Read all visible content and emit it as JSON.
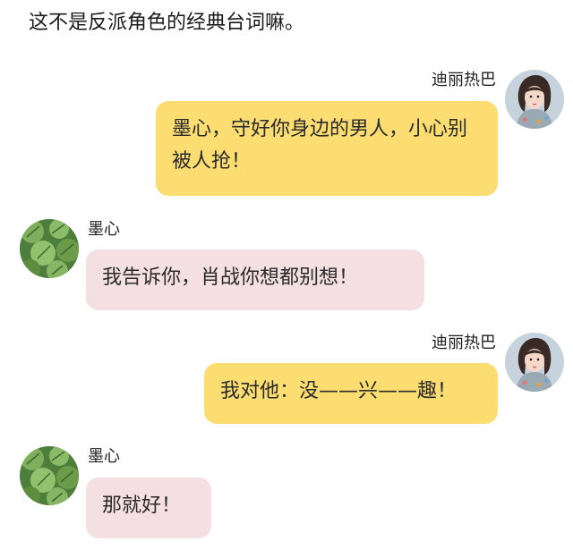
{
  "intro_text": "这不是反派角色的经典台词嘛。",
  "messages": [
    {
      "side": "right",
      "sender": "迪丽热巴",
      "text": "墨心，守好你身边的男人，小心别被人抢！",
      "avatar": "female-portrait-avatar"
    },
    {
      "side": "left",
      "sender": "墨心",
      "text": "我告诉你，肖战你想都别想！",
      "avatar": "green-leaf-avatar"
    },
    {
      "side": "right",
      "sender": "迪丽热巴",
      "text": "我对他：没——兴——趣！",
      "avatar": "female-portrait-avatar"
    },
    {
      "side": "left",
      "sender": "墨心",
      "text": "那就好！",
      "avatar": "green-leaf-avatar"
    }
  ],
  "colors": {
    "right_bubble": "#fbdd72",
    "left_bubble": "#f4dfe2",
    "background": "#ffffff"
  }
}
